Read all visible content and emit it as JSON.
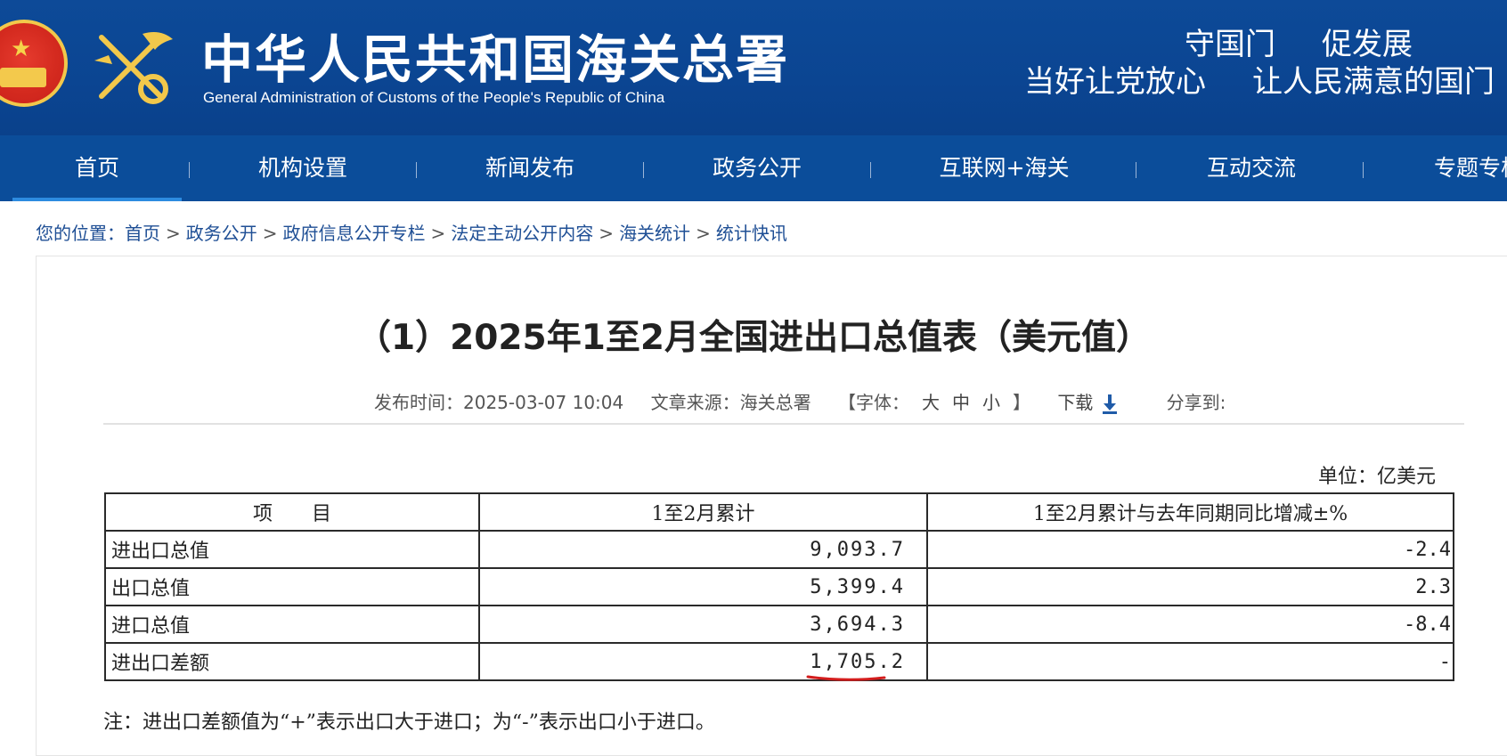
{
  "header": {
    "site_title": "中华人民共和国海关总署",
    "site_subtitle": "General Administration of Customs of the People's Republic of China",
    "slogan_line1": [
      "守国门",
      "促发展"
    ],
    "slogan_line2": [
      "当好让党放心",
      "让人民满意的国门"
    ],
    "bg_color": "#0b4a96"
  },
  "nav": {
    "items": [
      "首页",
      "机构设置",
      "新闻发布",
      "政务公开",
      "互联网+海关",
      "互动交流",
      "专题专栏"
    ],
    "active_index": 0
  },
  "breadcrumb": {
    "prefix": "您的位置：",
    "items": [
      "首页",
      "政务公开",
      "政府信息公开专栏",
      "法定主动公开内容",
      "海关统计",
      "统计快讯"
    ],
    "separator": ">"
  },
  "article": {
    "title": "（1）2025年1至2月全国进出口总值表（美元值）",
    "publish_label": "发布时间：",
    "publish_time": "2025-03-07 10:04",
    "source_label": "文章来源：",
    "source": "海关总署",
    "font_label": "【字体：",
    "font_options": [
      "大",
      "中",
      "小"
    ],
    "font_close": "】",
    "download_label": "下载",
    "share_label": "分享到:",
    "unit": "单位：亿美元"
  },
  "table": {
    "headers": [
      "项　　目",
      "1至2月累计",
      "1至2月累计与去年同期同比增减±%"
    ],
    "rows": [
      [
        "进出口总值",
        "9,093.7",
        "-2.4"
      ],
      [
        "出口总值",
        "5,399.4",
        "2.3"
      ],
      [
        "进口总值",
        "3,694.3",
        "-8.4"
      ],
      [
        "进出口差额",
        "1,705.2",
        "-"
      ]
    ],
    "highlight_color": "#d31d1d"
  },
  "note": "注：进出口差额值为“+”表示出口大于进口；为“-”表示出口小于进口。"
}
